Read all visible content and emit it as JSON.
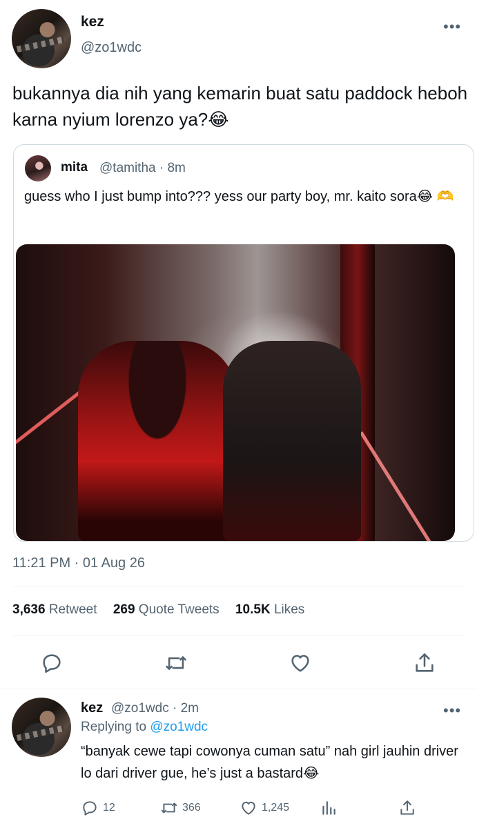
{
  "main_tweet": {
    "name": "kez",
    "handle": "@zo1wdc",
    "text": "bukannya dia nih yang kemarin buat satu paddock heboh karna nyium lorenzo ya?😂",
    "timestamp": "11:21 PM · 01 Aug 26"
  },
  "quote": {
    "name": "mita",
    "handle_time": "@tamitha · 8m",
    "text": "guess who I just bump into??? yess our party boy, mr. kaito sora😂 🫶"
  },
  "stats": {
    "retweet_count": "3,636",
    "retweet_label": "Retweet",
    "quote_count": "269",
    "quote_label": "Quote Tweets",
    "likes_count": "10.5K",
    "likes_label": "Likes"
  },
  "reply": {
    "name": "kez",
    "handle_time": "@zo1wdc · 2m",
    "replying_label": "Replying to",
    "replying_handle": "@zo1wdc",
    "text": "“banyak cewe tapi cowonya cuman satu” nah girl jauhin driver lo dari driver gue, he’s just a bastard😂",
    "reply_count": "12",
    "retweet_count": "366",
    "like_count": "1,245"
  },
  "icons": {
    "more": "more-horizontal-icon",
    "reply": "reply-icon",
    "retweet": "retweet-icon",
    "like": "heart-icon",
    "share": "share-icon",
    "analytics": "analytics-icon"
  },
  "colors": {
    "text": "#0f1419",
    "secondary": "#536471",
    "link": "#1d9bf0",
    "border": "#cfd9de"
  }
}
